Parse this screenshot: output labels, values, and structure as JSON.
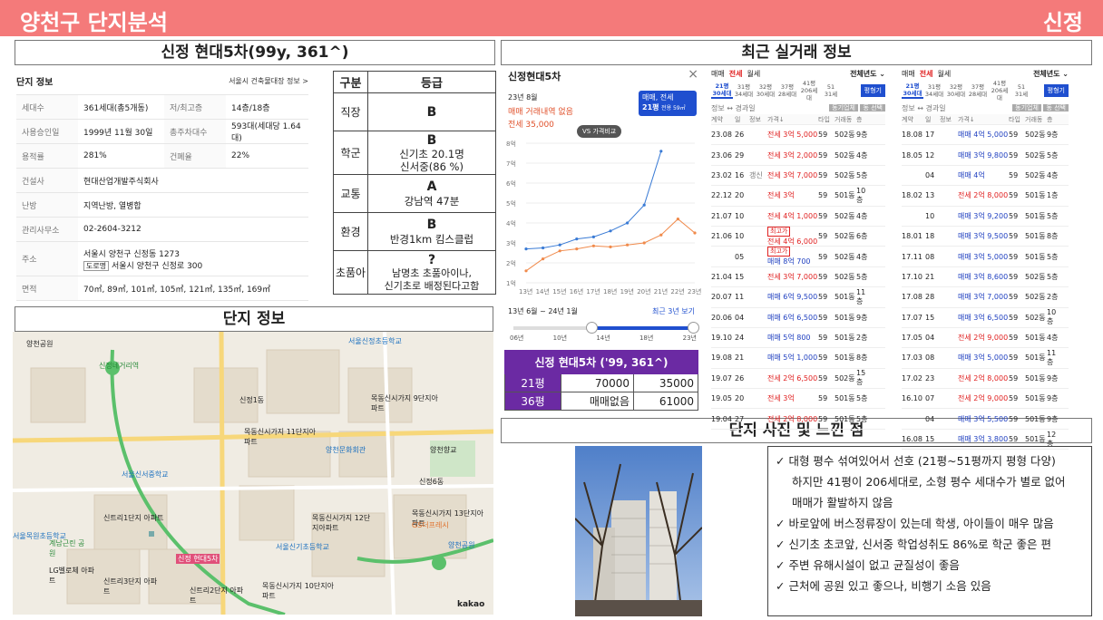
{
  "header": {
    "title": "양천구 단지분석",
    "region": "신정"
  },
  "sections": {
    "complex": "신정 현대5차(99y, 361^)",
    "map": "단지 정보",
    "trades": "최근 실거래 정보",
    "photo": "단지 사진 및 느낀 점"
  },
  "info": {
    "title": "단지 정보",
    "link": "서울시 건축물대장 정보 >",
    "rows": [
      {
        "k1": "세대수",
        "v1": "361세대(총5개동)",
        "k2": "저/최고층",
        "v2": "14층/18층"
      },
      {
        "k1": "사용승인일",
        "v1": "1999년 11월 30일",
        "k2": "총주차대수",
        "v2": "593대(세대당 1.64대)"
      },
      {
        "k1": "용적률",
        "v1": "281%",
        "k2": "건폐율",
        "v2": "22%"
      },
      {
        "k1": "건설사",
        "v1": "현대산업개발주식회사"
      },
      {
        "k1": "난방",
        "v1": "지역난방, 열병합"
      },
      {
        "k1": "관리사무소",
        "v1": "02-2604-3212"
      },
      {
        "k1": "주소",
        "v1": "서울시 양천구 신정동 1273",
        "v1b_tag": "도로명",
        "v1b": "서울시 양천구 신정로 300"
      },
      {
        "k1": "면적",
        "v1": "70㎡, 89㎡, 101㎡, 105㎡, 121㎡, 135㎡, 169㎡"
      }
    ]
  },
  "grade": {
    "h1": "구분",
    "h2": "등급",
    "rows": [
      {
        "cat": "직장",
        "g": "B",
        "d": ""
      },
      {
        "cat": "학군",
        "g": "B",
        "d": "신기초 20.1명\n신서중(86 %)"
      },
      {
        "cat": "교통",
        "g": "A",
        "d": "강남역 47분"
      },
      {
        "cat": "환경",
        "g": "B",
        "d": "반경1km 킴스클럽"
      },
      {
        "cat": "초품아",
        "g": "?",
        "d": "남명초 초품아이나,\n신기초로 배정된다고함"
      }
    ]
  },
  "chart_panel": {
    "name": "신정현대5차",
    "close": "×",
    "date": "23년 8월",
    "status": "매매 거래내역 없음",
    "jeonse": "전세 35,000",
    "sel1": "매매, 전세",
    "sel2": "21평",
    "sel2b": "전용 59㎡",
    "compare": "VS 가격비교",
    "range_label": "13년 6월 ~ 24년 1월",
    "range_link": "최근 3년 보기",
    "slider_ticks": [
      "06년",
      "10년",
      "14년",
      "18년",
      "23년"
    ]
  },
  "chart_data": {
    "type": "line",
    "x": [
      "13년",
      "14년",
      "15년",
      "16년",
      "17년",
      "18년",
      "19년",
      "20년",
      "21년",
      "22년",
      "23년"
    ],
    "ylim": [
      1,
      8
    ],
    "yticks": [
      "1억",
      "2억",
      "3억",
      "4억",
      "5억",
      "6억",
      "7억",
      "8억"
    ],
    "series": [
      {
        "name": "매매",
        "color": "#3a7bd5",
        "values": [
          2.7,
          2.75,
          2.9,
          3.2,
          3.3,
          3.6,
          4.0,
          4.9,
          7.6,
          null,
          null
        ]
      },
      {
        "name": "전세",
        "color": "#f08a4b",
        "values": [
          1.6,
          2.2,
          2.6,
          2.7,
          2.85,
          2.8,
          2.9,
          3.0,
          3.4,
          4.2,
          3.5
        ]
      }
    ]
  },
  "price_table": {
    "title": "신정 현대5차 ('99, 361^)",
    "rows": [
      {
        "size": "21평",
        "sale": "70000",
        "jeonse": "35000"
      },
      {
        "size": "36평",
        "sale": "매매없음",
        "jeonse": "61000"
      }
    ]
  },
  "rx_left": {
    "tabs": [
      "매매",
      "전세",
      "월세"
    ],
    "period": "전체년도 ⌄",
    "sizes": [
      "21평\n30세대",
      "31평\n34세대",
      "32평\n30세대",
      "37평\n28세대",
      "41평\n206세대",
      "51\n31세"
    ],
    "btn": "평형기",
    "legend": "정보 ↔ 경과일",
    "chip1": "동기업체",
    "chip2": "동 선택",
    "cols": [
      "계약",
      "일",
      "정보",
      "가격↓",
      "타입",
      "거래동",
      "층"
    ],
    "rows": [
      [
        "23.08",
        "26",
        "",
        "전세 3억 5,000",
        "59",
        "502동",
        "9층"
      ],
      [
        "23.06",
        "29",
        "",
        "전세 3억 2,000",
        "59",
        "502동",
        "4층"
      ],
      [
        "23.02",
        "16",
        "갱신",
        "전세 3억 7,000",
        "59",
        "502동",
        "5층"
      ],
      [
        "22.12",
        "20",
        "",
        "전세 3억",
        "59",
        "501동",
        "10층"
      ],
      [
        "21.07",
        "10",
        "",
        "전세 4억 1,000",
        "59",
        "502동",
        "4층"
      ],
      [
        "21.06",
        "10",
        "최고가",
        "전세 4억 6,000",
        "59",
        "502동",
        "6층"
      ],
      [
        "",
        "05",
        "최고가",
        "매매 8억 700",
        "59",
        "502동",
        "4층"
      ],
      [
        "21.04",
        "15",
        "",
        "전세 3억 7,000",
        "59",
        "502동",
        "5층"
      ],
      [
        "20.07",
        "11",
        "",
        "매매 6억 9,500",
        "59",
        "501동",
        "11층"
      ],
      [
        "20.06",
        "04",
        "",
        "매매 6억 6,500",
        "59",
        "501동",
        "9층"
      ],
      [
        "19.10",
        "24",
        "",
        "매매 5억 800",
        "59",
        "501동",
        "2층"
      ],
      [
        "19.08",
        "21",
        "",
        "매매 5억 1,000",
        "59",
        "501동",
        "8층"
      ],
      [
        "19.07",
        "26",
        "",
        "전세 2억 6,500",
        "59",
        "502동",
        "15층"
      ],
      [
        "19.05",
        "20",
        "",
        "전세 3억",
        "59",
        "501동",
        "5층"
      ],
      [
        "19.04",
        "27",
        "",
        "전세 2억 8,000",
        "59",
        "501동",
        "5층"
      ]
    ]
  },
  "rx_right": {
    "tabs": [
      "매매",
      "전세",
      "월세"
    ],
    "period": "전체년도 ⌄",
    "sizes": [
      "21평\n30세대",
      "31평\n34세대",
      "32평\n30세대",
      "37평\n28세대",
      "41평\n206세대",
      "51\n31세"
    ],
    "btn": "평형기",
    "legend": "정보 ↔ 경과일",
    "chip1": "동기업체",
    "chip2": "동 선택",
    "cols": [
      "계약",
      "일",
      "정보",
      "가격↓",
      "타입",
      "거래동",
      "층"
    ],
    "rows": [
      [
        "18.08",
        "17",
        "",
        "매매 4억 5,000",
        "59",
        "502동",
        "9층"
      ],
      [
        "18.05",
        "12",
        "",
        "매매 3억 9,800",
        "59",
        "502동",
        "5층"
      ],
      [
        "",
        "04",
        "",
        "매매 4억",
        "59",
        "502동",
        "4층"
      ],
      [
        "18.02",
        "13",
        "",
        "전세 2억 8,000",
        "59",
        "501동",
        "1층"
      ],
      [
        "",
        "10",
        "",
        "매매 3억 9,200",
        "59",
        "501동",
        "5층"
      ],
      [
        "18.01",
        "18",
        "",
        "매매 3억 9,500",
        "59",
        "501동",
        "8층"
      ],
      [
        "17.11",
        "08",
        "",
        "매매 3억 5,000",
        "59",
        "501동",
        "5층"
      ],
      [
        "17.10",
        "21",
        "",
        "매매 3억 8,600",
        "59",
        "502동",
        "5층"
      ],
      [
        "17.08",
        "28",
        "",
        "매매 3억 7,000",
        "59",
        "502동",
        "2층"
      ],
      [
        "17.07",
        "15",
        "",
        "매매 3억 6,500",
        "59",
        "502동",
        "10층"
      ],
      [
        "17.05",
        "04",
        "",
        "전세 2억 9,000",
        "59",
        "501동",
        "4층"
      ],
      [
        "17.03",
        "08",
        "",
        "매매 3억 5,000",
        "59",
        "501동",
        "11층"
      ],
      [
        "17.02",
        "23",
        "",
        "전세 2억 8,000",
        "59",
        "501동",
        "9층"
      ],
      [
        "16.10",
        "07",
        "",
        "전세 2억 9,000",
        "59",
        "501동",
        "9층"
      ],
      [
        "",
        "04",
        "",
        "매매 3억 5,500",
        "59",
        "501동",
        "9층"
      ],
      [
        "16.08",
        "15",
        "",
        "매매 3억 3,800",
        "59",
        "501동",
        "12층"
      ]
    ]
  },
  "notes": [
    "대형 평수 섞여있어서 선호 (21평~51평까지 평형 다양)",
    "하지만 41평이 206세대로, 소형 평수 세대수가 별로 없어",
    "매매가 활발하지 않음",
    "바로앞에 버스정류장이 있는데 학생, 아이들이 매우 많음",
    "신기초 초코앞, 신서중 학업성취도 86%로 학군 좋은 편",
    "주변 유해시설이 없고 균질성이 좋음",
    "근처에 공원 있고 좋으나, 비행기 소음 있음"
  ],
  "map": {
    "labels": [
      "양천공원",
      "신정1동",
      "서울신정초등학교",
      "서울신서중학교",
      "서울신기초등학교",
      "신정6동",
      "신정 현대5차",
      "목동신시가지 9단지아파트",
      "목동신시가지 11단지아파트",
      "목동신시가지 13단지아파트",
      "목동신시가지 12단지아파트",
      "목동신시가지 10단지아파트",
      "신트리1단지 아파트",
      "신트리3단지 아파트",
      "신트리2단지 아파트",
      "양천문화회관",
      "양천공원",
      "서울목원초등학교",
      "LG벨로체 아파트",
      "계남근린 공원",
      "GS더프레시",
      "양천향교",
      "신정네거리역"
    ],
    "logo": "kakao"
  }
}
